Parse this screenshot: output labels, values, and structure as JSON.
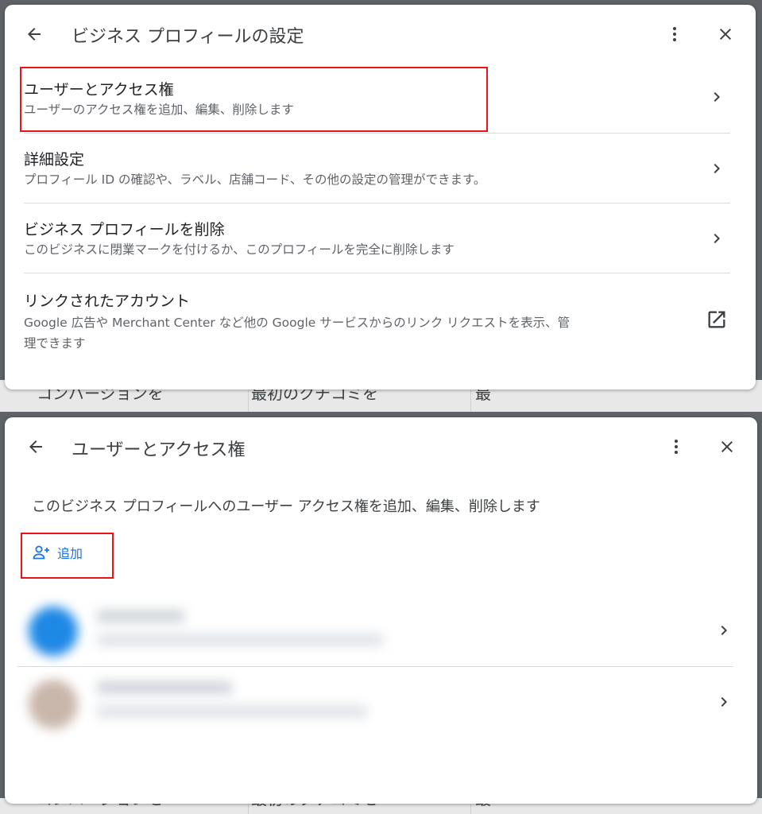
{
  "backdrop": {
    "cells": [
      "コンバージョンを",
      "最初のクチコミを",
      "最"
    ]
  },
  "settings_panel": {
    "title": "ビジネス プロフィールの設定",
    "items": [
      {
        "title": "ユーザーとアクセス権",
        "subtitle": "ユーザーのアクセス権を追加、編集、削除します",
        "action_icon": "chevron-right-icon"
      },
      {
        "title": "詳細設定",
        "subtitle": "プロフィール ID の確認や、ラベル、店舗コード、その他の設定の管理ができます。",
        "action_icon": "chevron-right-icon"
      },
      {
        "title": "ビジネス プロフィールを削除",
        "subtitle": "このビジネスに閉業マークを付けるか、このプロフィールを完全に削除します",
        "action_icon": "chevron-right-icon"
      },
      {
        "title": "リンクされたアカウント",
        "subtitle_line1": "Google 広告や Merchant Center など他の Google サービスからのリンク リクエストを表示、管",
        "subtitle_line2": "理できます",
        "action_icon": "open-in-new-icon"
      }
    ]
  },
  "users_panel": {
    "title": "ユーザーとアクセス権",
    "description": "このビジネス プロフィールへのユーザー アクセス権を追加、編集、削除します",
    "add_label": "追加",
    "users": [
      {
        "action_icon": "chevron-right-icon"
      },
      {
        "action_icon": "chevron-right-icon"
      }
    ]
  },
  "colors": {
    "accent": "#1a73e8",
    "highlight": "#e8141a",
    "divider": "#dadce0"
  }
}
